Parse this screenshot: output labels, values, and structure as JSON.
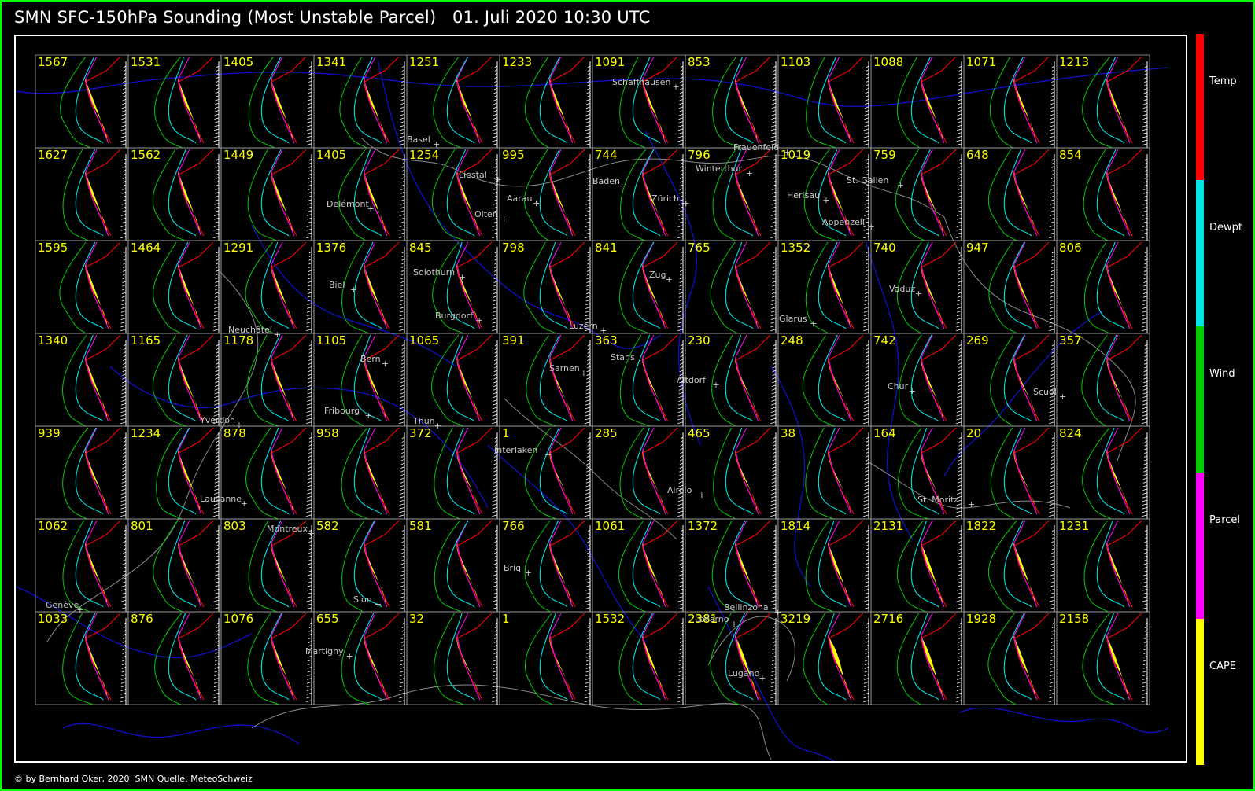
{
  "title": {
    "product": "SMN SFC-150hPa Sounding (Most Unstable Parcel)",
    "valid_time": "01. Juli 2020 10:30 UTC"
  },
  "footer": {
    "credit": "© by Bernhard Oker, 2020",
    "source": "SMN Quelle: MeteoSchweiz"
  },
  "legend": [
    {
      "label": "Temp",
      "color": "#ff0000"
    },
    {
      "label": "Dewpt",
      "color": "#00e5e5"
    },
    {
      "label": "Wind",
      "color": "#00cc00"
    },
    {
      "label": "Parcel",
      "color": "#ff00ff"
    },
    {
      "label": "CAPE",
      "color": "#ffff00"
    }
  ],
  "colors": {
    "background": "#000000",
    "frame": "#00ff00",
    "grid_border": "#a0a0a0",
    "river": "#1010c8",
    "border_line": "#8a8a8a",
    "city": "#c8c8c8",
    "cape_text": "#ffff00"
  },
  "chart_data": {
    "type": "heatmap",
    "rows": 7,
    "cols": 12,
    "cape_values": [
      [
        1567,
        1531,
        1405,
        1341,
        1251,
        1233,
        1091,
        853,
        1103,
        1088,
        1071,
        1213
      ],
      [
        1627,
        1562,
        1449,
        1405,
        1254,
        995,
        744,
        796,
        1019,
        759,
        648,
        854
      ],
      [
        1595,
        1464,
        1291,
        1376,
        845,
        798,
        841,
        765,
        1352,
        740,
        947,
        806
      ],
      [
        1340,
        1165,
        1178,
        1105,
        1065,
        391,
        363,
        230,
        248,
        742,
        269,
        357
      ],
      [
        939,
        1234,
        878,
        958,
        372,
        1,
        285,
        465,
        38,
        164,
        20,
        824
      ],
      [
        1062,
        801,
        803,
        582,
        581,
        766,
        1061,
        1372,
        1814,
        2131,
        1822,
        1231
      ],
      [
        1033,
        876,
        1076,
        655,
        32,
        1,
        1532,
        2381,
        3219,
        2716,
        1928,
        2158
      ]
    ],
    "cities": [
      {
        "name": "Schaffhausen"
      },
      {
        "name": "Basel"
      },
      {
        "name": "Frauenfeld"
      },
      {
        "name": "Liestal"
      },
      {
        "name": "Winterthur"
      },
      {
        "name": "Delémont"
      },
      {
        "name": "Aarau"
      },
      {
        "name": "Baden"
      },
      {
        "name": "Olten"
      },
      {
        "name": "Zürich"
      },
      {
        "name": "Herisau"
      },
      {
        "name": "St. Gallen"
      },
      {
        "name": "Appenzell"
      },
      {
        "name": "Solothurn"
      },
      {
        "name": "Biel"
      },
      {
        "name": "Zug"
      },
      {
        "name": "Vaduz"
      },
      {
        "name": "Neuchâtel"
      },
      {
        "name": "Burgdorf"
      },
      {
        "name": "Luzern"
      },
      {
        "name": "Glarus"
      },
      {
        "name": "Bern"
      },
      {
        "name": "Sarnen"
      },
      {
        "name": "Stans"
      },
      {
        "name": "Altdorf"
      },
      {
        "name": "Chur"
      },
      {
        "name": "Scuol"
      },
      {
        "name": "Fribourg"
      },
      {
        "name": "Yverdon"
      },
      {
        "name": "Thun"
      },
      {
        "name": "Interlaken"
      },
      {
        "name": "Lausanne"
      },
      {
        "name": "Airolo"
      },
      {
        "name": "St. Moritz"
      },
      {
        "name": "Montreux"
      },
      {
        "name": "Brig"
      },
      {
        "name": "Genève"
      },
      {
        "name": "Sion"
      },
      {
        "name": "Bellinzona"
      },
      {
        "name": "Martigny"
      },
      {
        "name": "Locarno"
      },
      {
        "name": "Lugano"
      }
    ]
  }
}
